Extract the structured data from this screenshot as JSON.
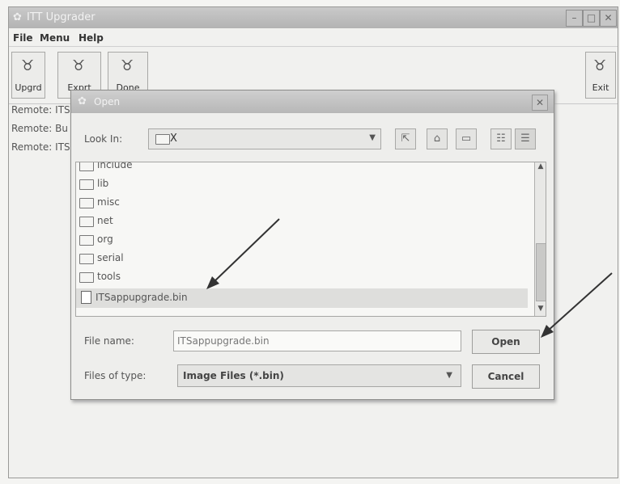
{
  "window": {
    "title": "ITT Upgrader",
    "controls": [
      "–",
      "□",
      "✕"
    ]
  },
  "menu": [
    "File",
    "Menu",
    "Help"
  ],
  "toolbar": {
    "upgrade": "Upgrd",
    "export": "Exprt",
    "done": "Done",
    "exit": "Exit"
  },
  "remote_lines": [
    "Remote: ITS",
    "Remote: Bu",
    "Remote: ITS"
  ],
  "dialog": {
    "title": "Open",
    "look_in_label": "Look In:",
    "look_in_value": "X",
    "items": [
      "include",
      "lib",
      "misc",
      "net",
      "org",
      "serial",
      "tools"
    ],
    "selected_file": "ITSappupgrade.bin",
    "file_name_label": "File name:",
    "file_name_value": "ITSappupgrade.bin",
    "files_of_type_label": "Files of type:",
    "files_of_type_value": "Image Files (*.bin)",
    "open_button": "Open",
    "cancel_button": "Cancel"
  }
}
